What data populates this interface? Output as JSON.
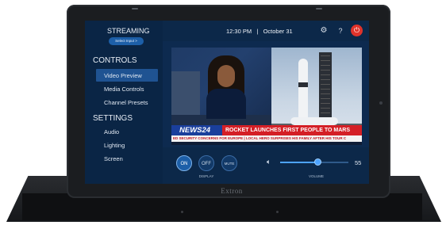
{
  "device": {
    "brand": "Extron"
  },
  "sidebar": {
    "streaming_title": "STREAMING",
    "select_input_label": "Select Input >",
    "controls_title": "CONTROLS",
    "controls_items": [
      {
        "label": "Video Preview",
        "selected": true
      },
      {
        "label": "Media Controls",
        "selected": false
      },
      {
        "label": "Channel Presets",
        "selected": false
      }
    ],
    "settings_title": "SETTINGS",
    "settings_items": [
      {
        "label": "Audio"
      },
      {
        "label": "Lighting"
      },
      {
        "label": "Screen"
      }
    ]
  },
  "topbar": {
    "time": "12:30 PM",
    "separator": "|",
    "date": "October 31",
    "icons": [
      "gear-icon",
      "help-icon",
      "power-icon"
    ],
    "help_glyph": "?"
  },
  "video": {
    "channel_logo": "NEWS24",
    "headline": "ROCKET LAUNCHES FIRST PEOPLE TO MARS",
    "ticker": "ED SECURITY CONCERNS FOR EUROPE  |  LOCAL HERO SURPRISES HIS FAMILY AFTER HIS TOUR C"
  },
  "display_controls": {
    "on_label": "ON",
    "off_label": "OFF",
    "mute_label": "MUTE",
    "display_label": "DISPLAY"
  },
  "volume": {
    "label": "VOLUME",
    "value": 55,
    "value_text": "55"
  },
  "colors": {
    "screen_bg": "#0d2a4f",
    "accent": "#1d5fa8",
    "power": "#e0332b",
    "ticker_blue": "#1a3f9c",
    "ticker_red": "#d41f26"
  }
}
